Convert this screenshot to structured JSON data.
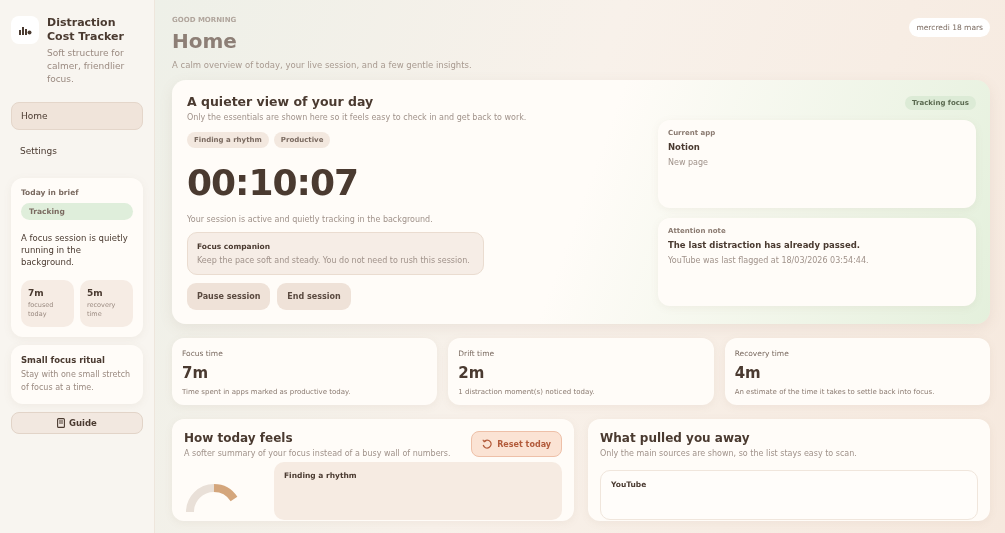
{
  "app": {
    "name": "Distraction Cost Tracker",
    "tagline": "Soft structure for calmer, friendlier focus."
  },
  "nav": [
    {
      "label": "Home",
      "selected": true
    },
    {
      "label": "Settings",
      "selected": false
    }
  ],
  "brief": {
    "title": "Today in brief",
    "status": "Tracking",
    "text": "A focus session is quietly running in the background.",
    "stats": [
      {
        "value": "7m",
        "label": "focused today"
      },
      {
        "value": "5m",
        "label": "recovery time"
      }
    ]
  },
  "ritual": {
    "title": "Small focus ritual",
    "text": "Stay with one small stretch of focus at a time."
  },
  "guide_button": "Guide",
  "header": {
    "greeting": "GOOD MORNING",
    "title": "Home",
    "subtitle": "A calm overview of today, your live session, and a few gentle insights.",
    "date": "mercredi 18 mars"
  },
  "session": {
    "title": "A quieter view of your day",
    "subtitle": "Only the essentials are shown here so it feels easy to check in and get back to work.",
    "badge": "Tracking focus",
    "tags": [
      "Finding a rhythm",
      "Productive"
    ],
    "timer": "00:10:07",
    "status": "Your session is active and quietly tracking in the background.",
    "companion": {
      "title": "Focus companion",
      "text": "Keep the pace soft and steady. You do not need to rush this session."
    },
    "buttons": [
      "Pause session",
      "End session"
    ],
    "current_app": {
      "label": "Current app",
      "name": "Notion",
      "detail": "New page"
    },
    "attention": {
      "label": "Attention note",
      "title": "The last distraction has already passed.",
      "text": "YouTube was last flagged at 18/03/2026 03:54:44."
    }
  },
  "stats": [
    {
      "label": "Focus time",
      "value": "7m",
      "note": "Time spent in apps marked as productive today."
    },
    {
      "label": "Drift time",
      "value": "2m",
      "note": "1 distraction moment(s) noticed today."
    },
    {
      "label": "Recovery time",
      "value": "4m",
      "note": "An estimate of the time it takes to settle back into focus."
    }
  ],
  "feels": {
    "title": "How today feels",
    "subtitle": "A softer summary of your focus instead of a busy wall of numbers.",
    "reset_button": "Reset today",
    "mood": "Finding a rhythm"
  },
  "pulled": {
    "title": "What pulled you away",
    "subtitle": "Only the main sources are shown, so the list stays easy to scan.",
    "sources": [
      "YouTube"
    ]
  }
}
